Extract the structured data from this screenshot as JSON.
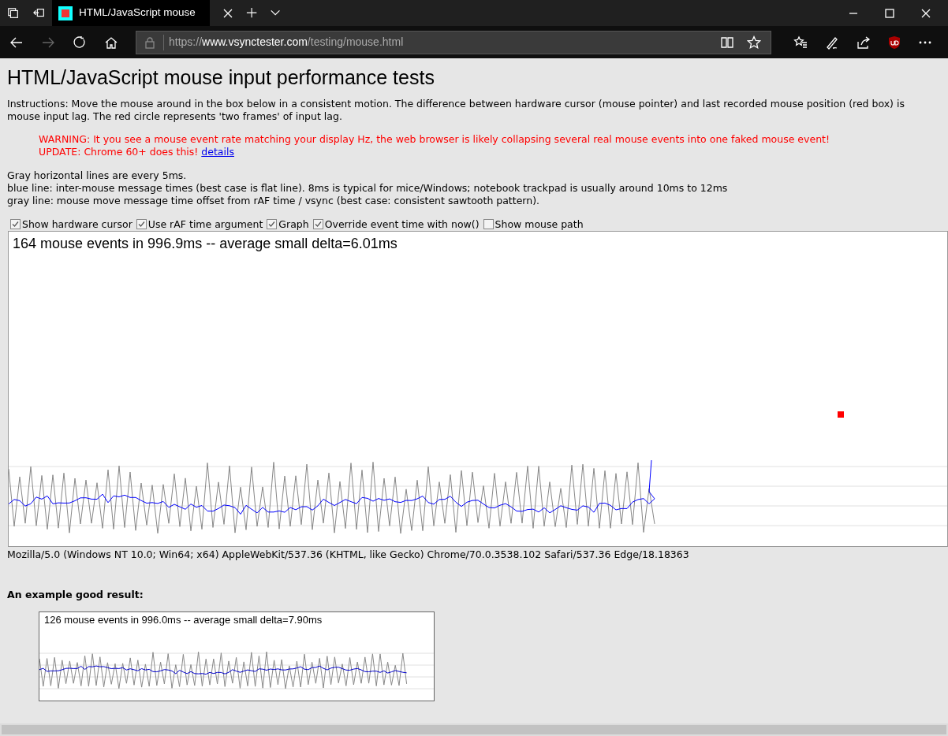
{
  "browser": {
    "tab_title": "HTML/JavaScript mouse",
    "url": {
      "scheme": "https://",
      "host": "www.vsynctester.com",
      "path": "/testing/mouse.html"
    }
  },
  "page": {
    "title": "HTML/JavaScript mouse input performance tests",
    "instructions": "Instructions: Move the mouse around in the box below in a consistent motion. The difference between hardware cursor (mouse pointer) and last recorded mouse position (red box) is mouse input lag. The red circle represents 'two frames' of input lag.",
    "warning": "WARNING: It you see a mouse event rate matching your display Hz, the web browser is likely collapsing several real mouse events into one faked mouse event!",
    "update": {
      "text": "UPDATE: Chrome 60+ does this!",
      "link": "details"
    },
    "notes": [
      "Gray horizontal lines are every 5ms.",
      "blue line: inter-mouse message times (best case is flat line). 8ms is typical for mice/Windows; notebook trackpad is usually around 10ms to 12ms",
      "gray line: mouse move message time offset from rAF time / vsync (best case: consistent sawtooth pattern)."
    ],
    "options": [
      {
        "label": "Show hardware cursor",
        "checked": true
      },
      {
        "label": "Use rAF time argument",
        "checked": true
      },
      {
        "label": "Graph",
        "checked": true
      },
      {
        "label": "Override event time with now()",
        "checked": true
      },
      {
        "label": "Show mouse path",
        "checked": false
      }
    ],
    "canvas": {
      "stats": "164 mouse events in 996.9ms -- average small delta=6.01ms"
    },
    "user_agent": "Mozilla/5.0 (Windows NT 10.0; Win64; x64) AppleWebKit/537.36 (KHTML, like Gecko) Chrome/70.0.3538.102 Safari/537.36 Edge/18.18363",
    "example": {
      "heading": "An example good result:",
      "stats": "126 mouse events in 996.0ms -- average small delta=7.90ms"
    }
  }
}
